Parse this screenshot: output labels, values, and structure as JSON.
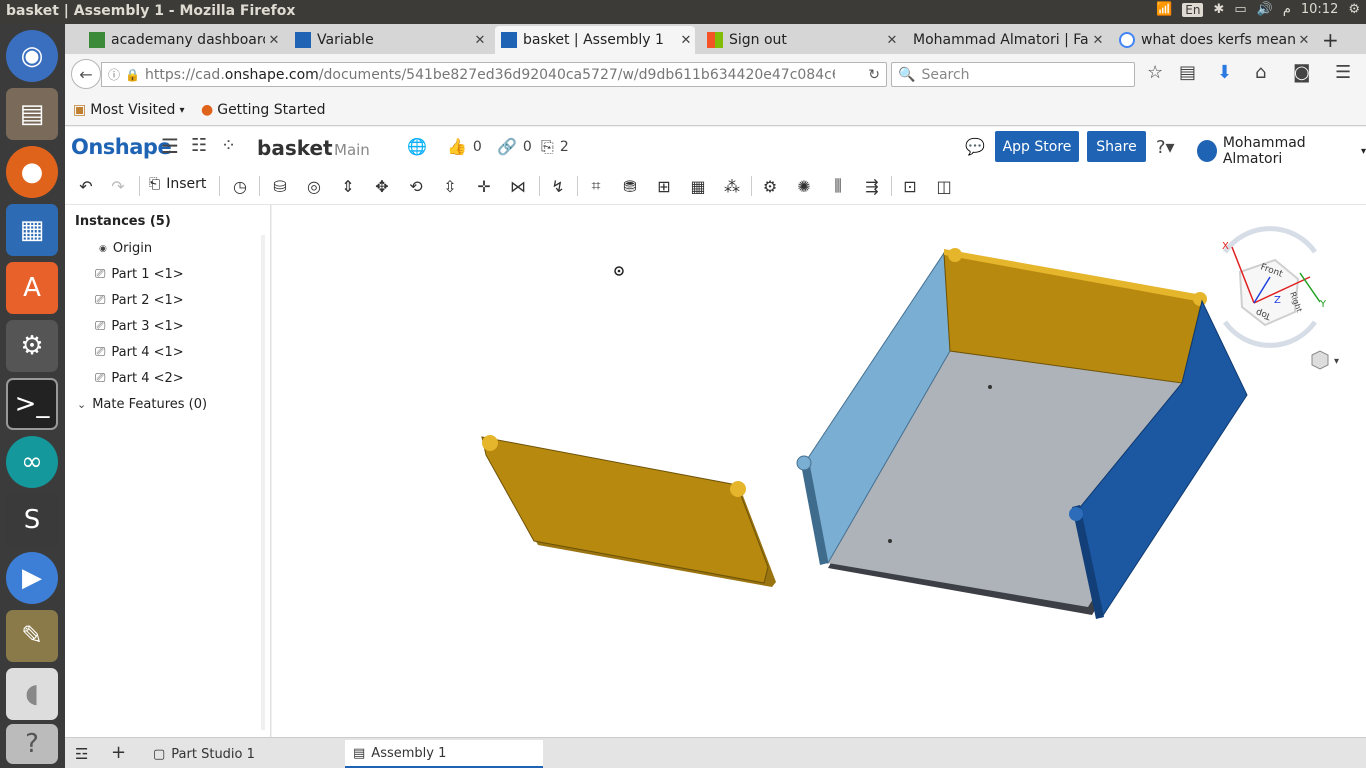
{
  "window_title": "basket | Assembly 1 - Mozilla Firefox",
  "system_tray": {
    "lang": "En",
    "time": "10:12",
    "suffix": "م"
  },
  "tabs": [
    {
      "label": "academany dashboard",
      "favicon": "green"
    },
    {
      "label": "Variable",
      "favicon": "onshape"
    },
    {
      "label": "basket | Assembly 1",
      "favicon": "onshape",
      "active": true
    },
    {
      "label": "Sign out",
      "favicon": "microsoft"
    },
    {
      "label": "Mohammad Almatori | Fa",
      "favicon": "none"
    },
    {
      "label": "what does kerfs mean",
      "favicon": "google"
    }
  ],
  "url": {
    "prefix": "https://cad.",
    "domain": "onshape.com",
    "path": "/documents/541be827ed36d92040ca5727/w/d9db611b634420e47c084c64/"
  },
  "search_placeholder": "Search",
  "bookmarks": {
    "most_visited": "Most Visited",
    "getting_started": "Getting Started"
  },
  "app": {
    "logo": "Onshape",
    "doc_name": "basket",
    "branch": "Main",
    "likes": "0",
    "links": "0",
    "copies": "2",
    "app_store": "App Store",
    "share": "Share",
    "user": "Mohammad Almatori"
  },
  "toolbar": {
    "insert": "Insert"
  },
  "instances": {
    "title": "Instances (5)",
    "items": [
      "Origin",
      "Part 1 <1>",
      "Part 2 <1>",
      "Part 3 <1>",
      "Part 4 <1>",
      "Part 4 <2>"
    ],
    "mate_features": "Mate Features (0)"
  },
  "viewcube": {
    "front": "Front",
    "top": "Top",
    "right": "Right",
    "x": "X",
    "y": "Y",
    "z": "Z"
  },
  "bottom_tabs": {
    "part_studio": "Part Studio 1",
    "assembly": "Assembly 1"
  }
}
